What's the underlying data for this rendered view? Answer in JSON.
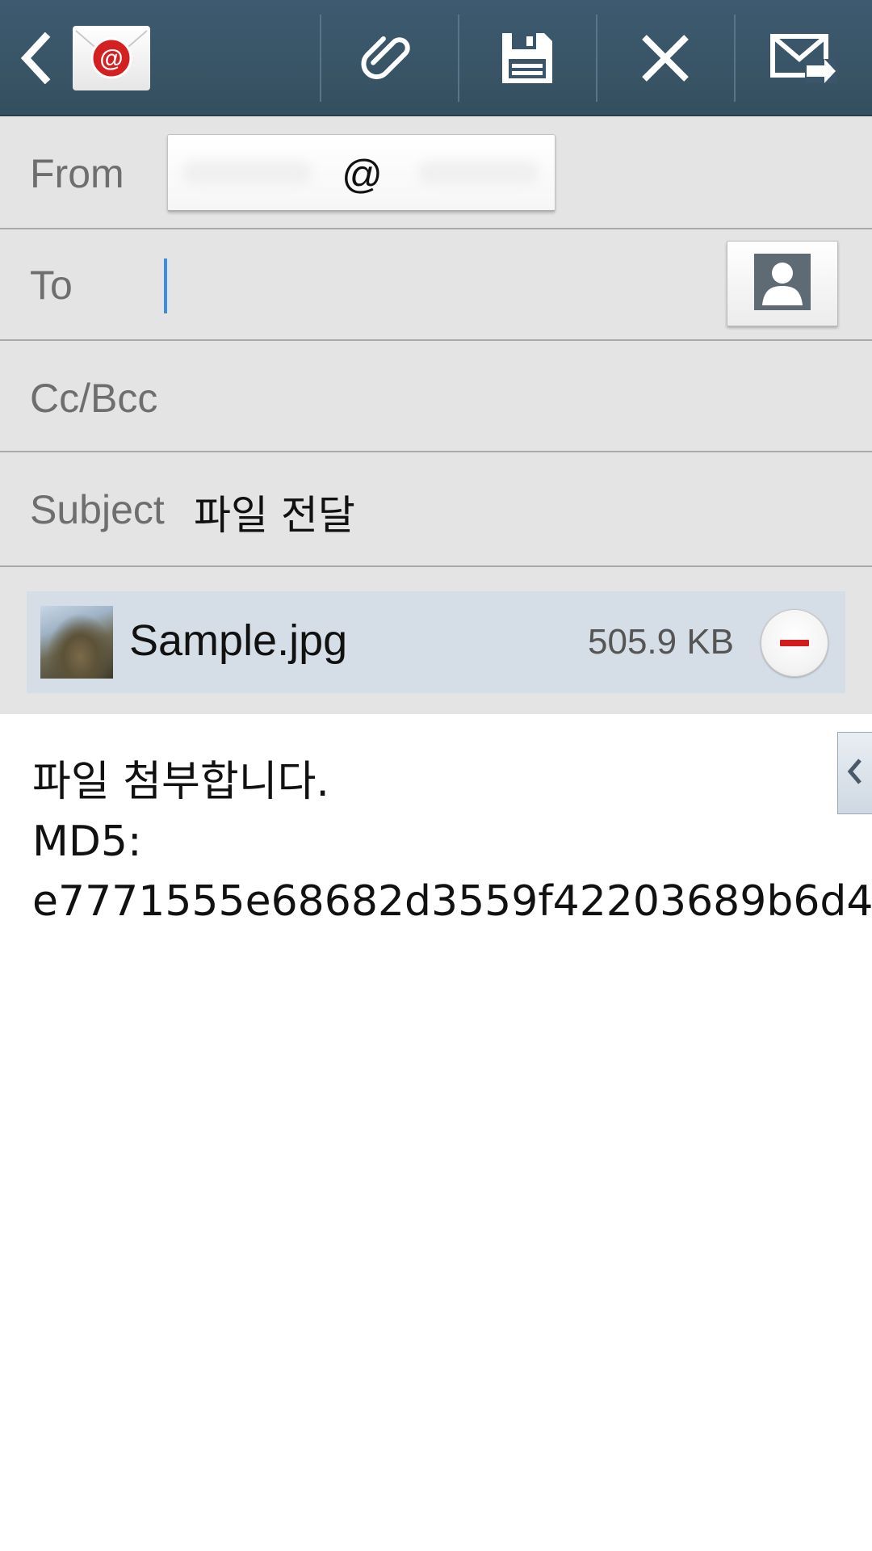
{
  "action_bar": {
    "back_icon": "chevron-left-icon",
    "app_icon": "email-app-icon",
    "app_icon_glyph": "@",
    "actions": [
      {
        "name": "attach",
        "icon": "paperclip-icon"
      },
      {
        "name": "save",
        "icon": "save-icon"
      },
      {
        "name": "discard",
        "icon": "close-icon"
      },
      {
        "name": "send",
        "icon": "send-mail-icon"
      }
    ],
    "colors": {
      "background": "#3b566b",
      "icon": "#ffffff"
    }
  },
  "fields": {
    "from": {
      "label": "From",
      "value": "@"
    },
    "to": {
      "label": "To",
      "value": "",
      "contact_icon": "contact-picker-icon"
    },
    "cc_bcc": {
      "label": "Cc/Bcc"
    },
    "subject": {
      "label": "Subject",
      "value": "파일 전달"
    }
  },
  "attachment": {
    "file_name": "Sample.jpg",
    "file_size": "505.9 KB",
    "remove_icon": "remove-icon"
  },
  "body": {
    "lines": [
      "파일 첨부합니다.",
      "MD5:",
      "e7771555e68682d3559f42203689b6d4"
    ],
    "side_tab_icon": "chevron-left-icon"
  },
  "colors": {
    "field_background": "#e4e4e4",
    "attachment_card": "#d5dde6",
    "cursor": "#3a8fe0",
    "remove_accent": "#d41c1c"
  }
}
